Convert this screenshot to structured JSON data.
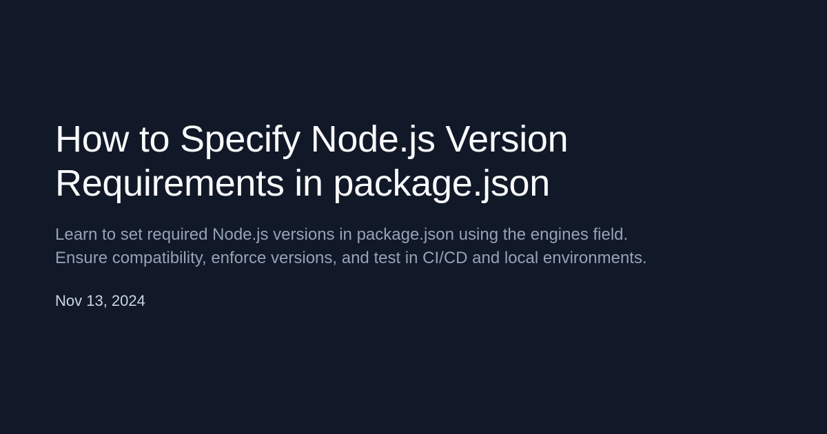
{
  "page": {
    "background_color": "#111827"
  },
  "article": {
    "title_lines": [
      "How to Specify Node.js Version",
      "Requirements in package.json"
    ],
    "description_lines": [
      "Learn to set required Node.js versions in package.json using the engines field.",
      "Ensure compatibility, enforce versions, and test in CI/CD and local environments."
    ],
    "date": "Nov 13, 2024",
    "title_color": "#f8fafc",
    "description_color": "#94a3b8",
    "date_color": "#cbd5e1"
  }
}
